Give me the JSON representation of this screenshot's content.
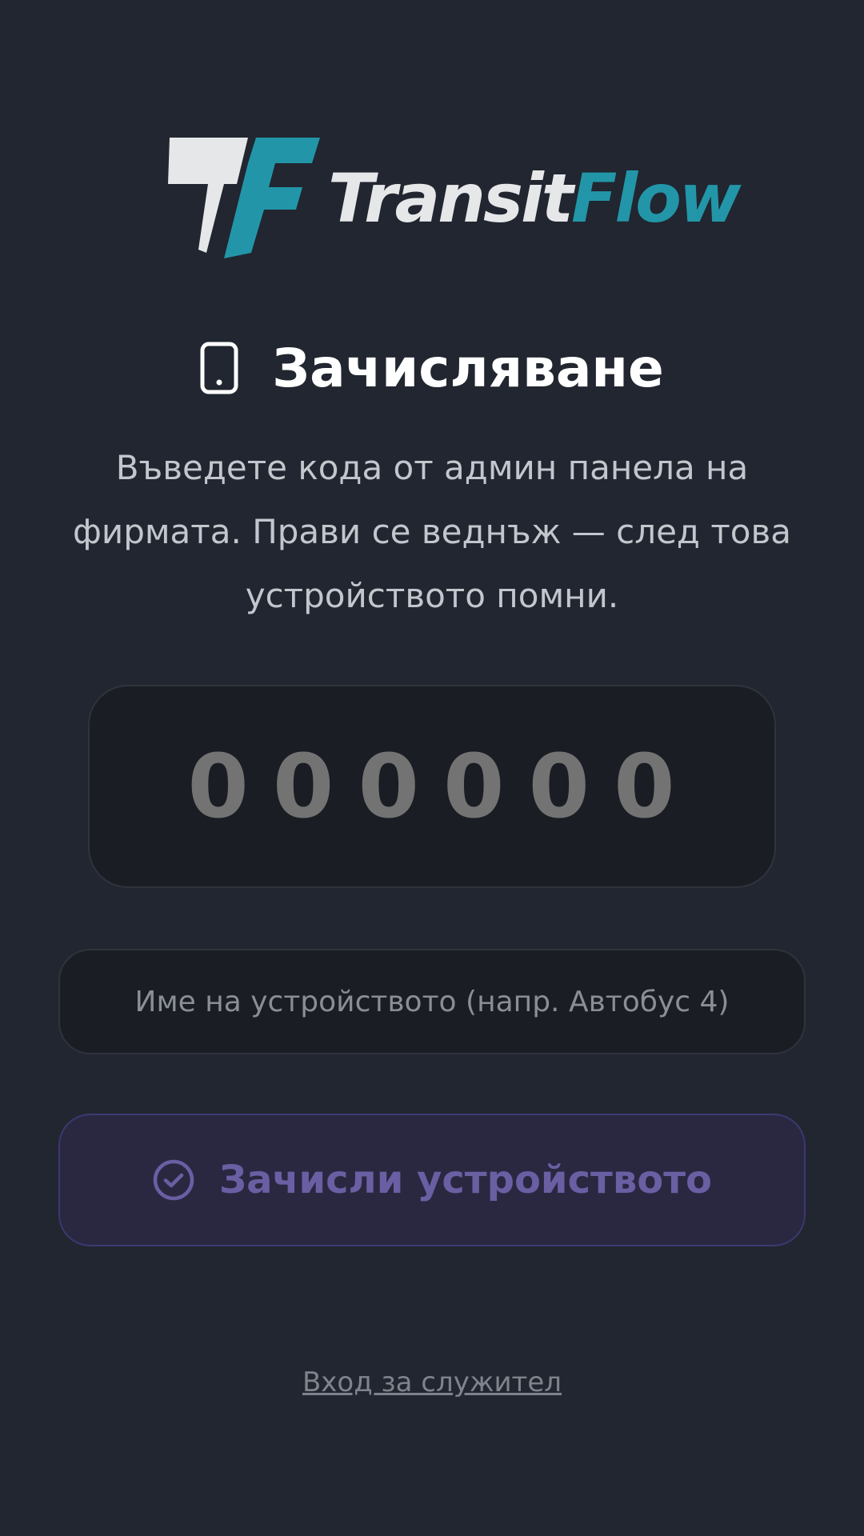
{
  "brand": {
    "logo_icon": "tf-monogram",
    "name_part1": "Transit",
    "name_part2": "Flow",
    "colors": {
      "light": "#e6e7e9",
      "accent": "#2296a8"
    }
  },
  "enroll": {
    "icon": "phone-icon",
    "title": "Зачисляване",
    "description": "Въведете кода от админ панела на фирмата. Прави се веднъж — след това устройството помни."
  },
  "code_field": {
    "placeholder": "000000",
    "value": ""
  },
  "device_name_field": {
    "placeholder": "Име на устройството (напр. Автобус 4)",
    "value": ""
  },
  "submit": {
    "icon": "check-circle-icon",
    "label": "Зачисли устройството",
    "color": "#6a5fa3"
  },
  "staff_login": {
    "label": "Вход за служител"
  }
}
